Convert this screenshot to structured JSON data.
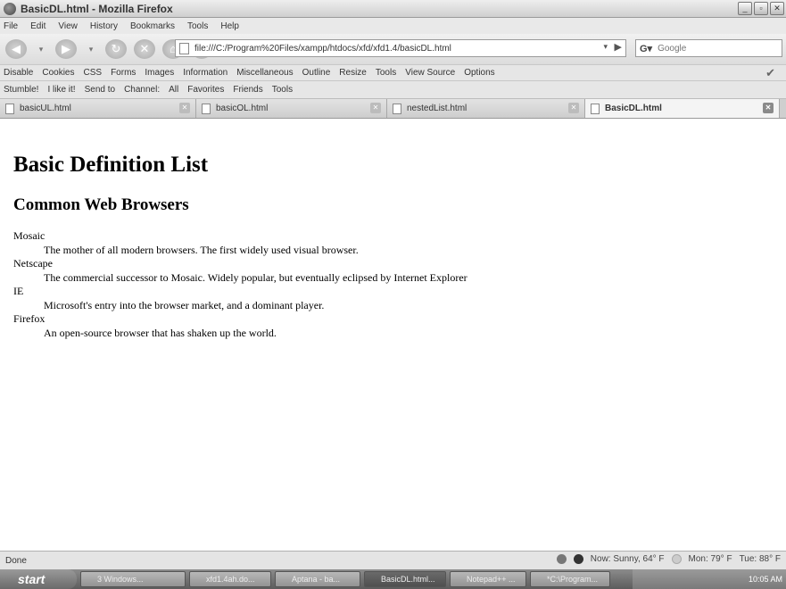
{
  "window": {
    "title": "BasicDL.html - Mozilla Firefox"
  },
  "menu": [
    "File",
    "Edit",
    "View",
    "History",
    "Bookmarks",
    "Tools",
    "Help"
  ],
  "nav": {
    "url": "file:///C:/Program%20Files/xampp/htdocs/xfd/xfd1.4/basicDL.html",
    "search_placeholder": "Google"
  },
  "webdev_toolbar": [
    "Disable",
    "Cookies",
    "CSS",
    "Forms",
    "Images",
    "Information",
    "Miscellaneous",
    "Outline",
    "Resize",
    "Tools",
    "View Source",
    "Options"
  ],
  "stumble_toolbar": [
    "Stumble!",
    "I like it!",
    "Send to",
    "Channel:",
    "All",
    "Favorites",
    "Friends",
    "Tools"
  ],
  "tabs": [
    "basicUL.html",
    "basicOL.html",
    "nestedList.html",
    "BasicDL.html"
  ],
  "page": {
    "h1": "Basic Definition List",
    "h2": "Common Web Browsers",
    "definitions": [
      {
        "term": "Mosaic",
        "desc": "The mother of all modern browsers. The first widely used visual browser."
      },
      {
        "term": "Netscape",
        "desc": "The commercial successor to Mosaic. Widely popular, but eventually eclipsed by Internet Explorer"
      },
      {
        "term": "IE",
        "desc": "Microsoft's entry into the browser market, and a dominant player."
      },
      {
        "term": "Firefox",
        "desc": "An open-source browser that has shaken up the world."
      }
    ]
  },
  "status": {
    "text": "Done",
    "weather_now": "Now: Sunny, 64° F",
    "weather_mon": "Mon: 79° F",
    "weather_tue": "Tue: 88° F"
  },
  "taskbar": {
    "start": "start",
    "items": [
      "3 Windows...",
      "xfd1.4ah.do...",
      "Aptana - ba...",
      "BasicDL.html...",
      "Notepad++ ...",
      "*C:\\Program..."
    ],
    "clock": "10:05 AM"
  }
}
